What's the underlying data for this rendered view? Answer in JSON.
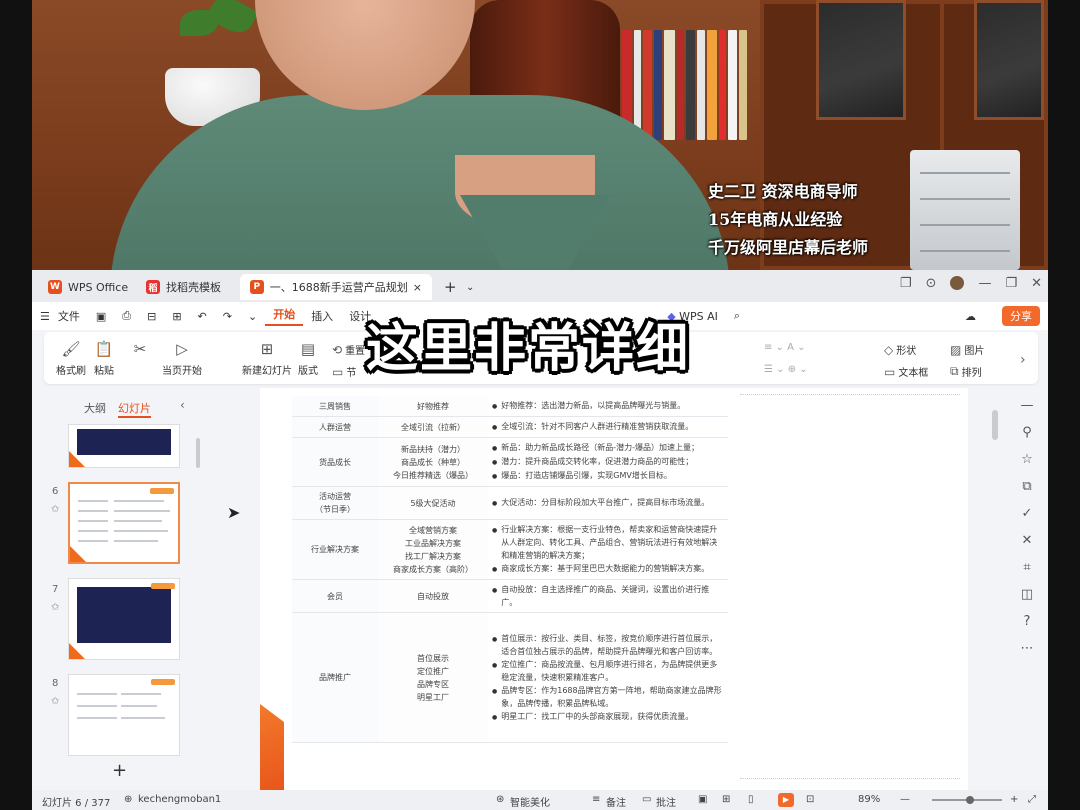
{
  "caption": {
    "line1": "史二卫 资深电商导师",
    "line2": "15年电商从业经验",
    "line3": "千万级阿里店幕后老师"
  },
  "overlay_text": "这里非常详细",
  "tabs": [
    {
      "label": "WPS Office",
      "icon": "wps-logo"
    },
    {
      "label": "找稻壳模板",
      "icon": "docer-logo"
    },
    {
      "label": "一、1688新手运营产品规划.pptx",
      "icon": "pptx-logo"
    }
  ],
  "menubar": {
    "file": "文件",
    "items": [
      "开始",
      "插入",
      "设计"
    ],
    "active": "开始",
    "wps_ai": "WPS AI",
    "share": "分享"
  },
  "ribbon": {
    "format_painter": "格式刷",
    "paste": "粘贴",
    "from_current": "当页开始",
    "new_slide": "新建幻灯片",
    "layout": "版式",
    "section": "节",
    "reset": "重置",
    "shape": "形状",
    "picture": "图片",
    "textbox": "文本框",
    "arrange": "排列"
  },
  "panel": {
    "tab_outline": "大纲",
    "tab_slides": "幻灯片",
    "slide_numbers": [
      "6",
      "7",
      "8"
    ]
  },
  "slide_table": [
    {
      "c1": "三周销售",
      "c2": "好物推荐",
      "c3": [
        {
          "text": "好物推荐：选出潜力新品，以提高品牌曝光与销量。"
        }
      ]
    },
    {
      "c1": "人群运营",
      "c2": "全域引流（拉新）",
      "c3": [
        {
          "text": "全域引流：针对不同客户人群进行精准营销获取流量。"
        }
      ]
    },
    {
      "c1": "货品成长",
      "c2": "新品扶持（潜力）\n商品成长（种草）\n今日推荐精选（爆品）",
      "c3": [
        {
          "text": "新品：助力新品成长路径（新品-潜力-爆品）加速上量；"
        },
        {
          "text": "潜力：提升商品成交转化率，促进潜力商品的可能性；"
        },
        {
          "text": "爆品：打造店铺爆品引爆，实现GMV增长目标。"
        }
      ]
    },
    {
      "c1": "活动运营\n（节日季）",
      "c2": "5级大促活动",
      "c3": [
        {
          "text": "大促活动：分目标阶段加大平台推广，提高目标市场流量。"
        }
      ]
    },
    {
      "c1": "行业解决方案",
      "c2": "全域营销方案\n工业品解决方案\n找工厂解决方案\n商家成长方案（高阶）",
      "c3": [
        {
          "text": "行业解决方案：根据一支行业特色，帮卖家和运营商快速提升从人群定向、转化工具、产品组合、营销玩法进行有效地解决和精准营销的解决方案；"
        },
        {
          "text": "商家成长方案：基于阿里巴巴大数据能力的营销解决方案。"
        }
      ]
    },
    {
      "c1": "会员",
      "c2": "自动投放",
      "c3": [
        {
          "text": "自动投放：自主选择推广的商品、关键词，设置出价进行推广。"
        }
      ]
    },
    {
      "c1": "品牌推广",
      "c2": "首位展示\n定位推广\n品牌专区\n明星工厂",
      "c3": [
        {
          "text": "首位展示：按行业、类目、标签，按竞价顺序进行首位展示，适合首位独占展示的品牌，帮助提升品牌曝光和客户回访率。"
        },
        {
          "text": "定位推广：商品按流量、包月顺序进行排名，为品牌提供更多稳定流量，快速积累精准客户。"
        },
        {
          "text": "品牌专区：作为1688品牌官方第一阵地，帮助商家建立品牌形象，品牌传播，积累品牌私域。"
        },
        {
          "text": "明星工厂：找工厂中的头部商家展现，获得优质流量。"
        }
      ]
    }
  ],
  "status": {
    "slide_counter": "幻灯片 6 / 377",
    "template": "kechengmoban1",
    "smart_beautify": "智能美化",
    "notes": "备注",
    "comments": "批注",
    "zoom": "89%",
    "zoom_fraction": 0.55
  },
  "colors": {
    "accent": "#e4511e",
    "share": "#f16a2c",
    "highlight_text": "#2c4a96"
  }
}
